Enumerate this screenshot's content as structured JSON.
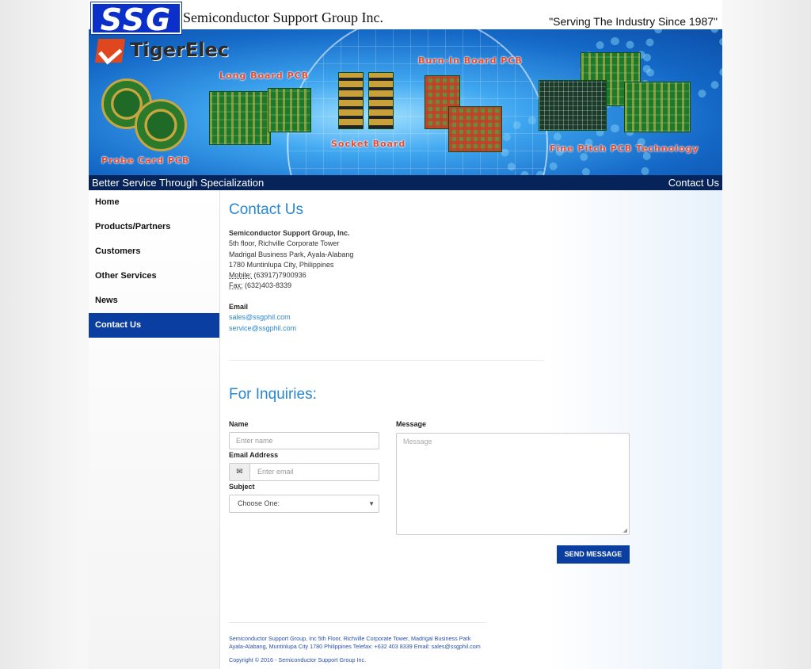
{
  "header": {
    "logo_text": "SSG",
    "company_name": "Semiconductor Support Group Inc.",
    "slogan": "\"Serving The Industry Since 1987\""
  },
  "banner": {
    "brand": "TigerElec",
    "labels": {
      "probe_card": "Probe Card PCB",
      "long_board": "Long Board PCB",
      "socket_board": "Socket Board",
      "burn_in": "Burn-In Board PCB",
      "fine_pitch": "Fine Pitch PCB Technology"
    }
  },
  "strip": {
    "tagline": "Better Service Through Specialization",
    "page_name": "Contact Us"
  },
  "sidebar": {
    "items": [
      {
        "label": "Home"
      },
      {
        "label": "Products/Partners"
      },
      {
        "label": "Customers"
      },
      {
        "label": "Other Services"
      },
      {
        "label": "News"
      },
      {
        "label": "Contact Us"
      }
    ],
    "active_index": 5
  },
  "contact": {
    "title": "Contact Us",
    "company": "Semiconductor Support Group, Inc.",
    "address_lines": [
      "5th floor, Richville Corporate Tower",
      "Madrigal Business Park, Ayala-Alabang",
      "1780 Muntinlupa City, Philippines"
    ],
    "mobile_label": "Mobile:",
    "mobile": "(63917)7900936",
    "fax_label": "Fax:",
    "fax": "(632)403-8339",
    "email_label": "Email",
    "emails": [
      "sales@ssgphil.com",
      "service@ssgphil.com"
    ]
  },
  "inquiry": {
    "title": "For Inquiries:",
    "name_label": "Name",
    "name_placeholder": "Enter name",
    "email_label": "Email Address",
    "email_placeholder": "Enter email",
    "subject_label": "Subject",
    "subject_value": "Choose One:",
    "message_label": "Message",
    "message_placeholder": "Message",
    "send_label": "SEND MESSAGE"
  },
  "footer": {
    "address_line1": "Semiconductor Support Group, Inc 5th Floor, Richville Corporate Tower, Madrigal Business Park",
    "address_line2": "Ayala-Alabang, Muntinlupa City 1780 Philippines Telefax: +632 403 8339 Email: sales@ssgphil.com",
    "copyright": "Copyright © 2016 - Semiconductor Support Group Inc."
  },
  "colors": {
    "accent": "#2a87d0",
    "nav_active": "#0a3ea0",
    "strip": "#06245a",
    "logo_blue": "#0b2fc9"
  },
  "icons": {
    "email_addon": "envelope-icon",
    "select_caret": "caret-down-icon"
  }
}
